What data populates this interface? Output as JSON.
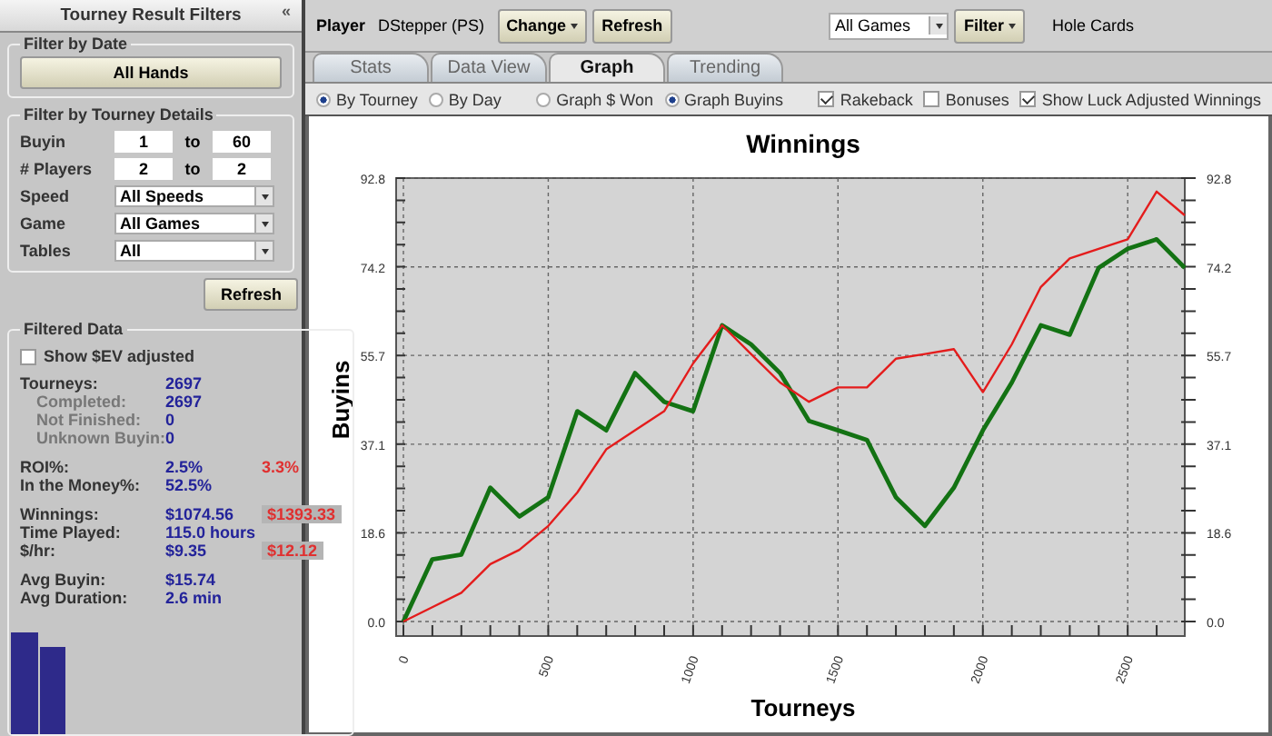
{
  "filters_panel": {
    "title": "Tourney Result Filters",
    "collapse_glyph": "«",
    "date_group": {
      "title": "Filter by Date",
      "button": "All Hands"
    },
    "details_group": {
      "title": "Filter by Tourney Details",
      "ranges": [
        {
          "label": "Buyin",
          "from": "1",
          "to_word": "to",
          "to": "60"
        },
        {
          "label": "# Players",
          "from": "2",
          "to_word": "to",
          "to": "2"
        }
      ],
      "selects": [
        {
          "label": "Speed",
          "value": "All Speeds"
        },
        {
          "label": "Game",
          "value": "All Games"
        },
        {
          "label": "Tables",
          "value": "All"
        }
      ]
    },
    "refresh_button": "Refresh",
    "data_group": {
      "title": "Filtered Data",
      "ev_checkbox": {
        "label": "Show $EV adjusted",
        "checked": false
      },
      "groups": [
        [
          {
            "label": "Tourneys:",
            "value": "2697",
            "sub": false
          },
          {
            "label": "Completed:",
            "value": "2697",
            "sub": true
          },
          {
            "label": "Not Finished:",
            "value": "0",
            "sub": true
          },
          {
            "label": "Unknown Buyin:",
            "value": "0",
            "sub": true
          }
        ],
        [
          {
            "label": "ROI%:",
            "value": "2.5%",
            "alt": "3.3%",
            "alt_boxed": false,
            "sub": false
          },
          {
            "label": "In the Money%:",
            "value": "52.5%",
            "sub": false
          }
        ],
        [
          {
            "label": "Winnings:",
            "value": "$1074.56",
            "alt": "$1393.33",
            "alt_boxed": true,
            "sub": false
          },
          {
            "label": "Time Played:",
            "value": "115.0 hours",
            "sub": false
          },
          {
            "label": "$/hr:",
            "value": "$9.35",
            "alt": "$12.12",
            "alt_boxed": true,
            "sub": false
          }
        ],
        [
          {
            "label": "Avg Buyin:",
            "value": "$15.74",
            "sub": false
          },
          {
            "label": "Avg Duration:",
            "value": "2.6 min",
            "sub": false
          }
        ]
      ]
    }
  },
  "toolbar": {
    "player_label": "Player",
    "player": "DStepper (PS)",
    "change_button": "Change",
    "refresh_button": "Refresh",
    "game_select": "All Games",
    "filter_button": "Filter",
    "hole_cards": "Hole Cards"
  },
  "tabs": [
    {
      "label": "Stats",
      "selected": false
    },
    {
      "label": "Data View",
      "selected": false
    },
    {
      "label": "Graph",
      "selected": true
    },
    {
      "label": "Trending",
      "selected": false
    }
  ],
  "options": {
    "view_by": [
      {
        "label": "By Tourney",
        "selected": true
      },
      {
        "label": "By Day",
        "selected": false
      }
    ],
    "graph_mode": [
      {
        "label": "Graph $ Won",
        "selected": false
      },
      {
        "label": "Graph Buyins",
        "selected": true
      }
    ],
    "checkboxes": [
      {
        "label": "Rakeback",
        "checked": true
      },
      {
        "label": "Bonuses",
        "checked": false
      },
      {
        "label": "Show Luck Adjusted Winnings",
        "checked": true
      }
    ]
  },
  "graph": {
    "chart_data": {
      "type": "line",
      "grid": true,
      "title": "Winnings",
      "xlabel": "Tourneys",
      "ylabel": "Buyins",
      "x": [
        0,
        100,
        200,
        300,
        400,
        500,
        600,
        700,
        800,
        900,
        1000,
        1100,
        1200,
        1300,
        1400,
        1500,
        1600,
        1700,
        1800,
        1900,
        2000,
        2100,
        2200,
        2300,
        2400,
        2500,
        2600,
        2697
      ],
      "series": [
        {
          "color": "#137213",
          "values": [
            0,
            13,
            14,
            28,
            22,
            26,
            44,
            40,
            52,
            46,
            44,
            62,
            58,
            52,
            42,
            40,
            38,
            26,
            20,
            28,
            40,
            50,
            62,
            60,
            74,
            78,
            80,
            74
          ]
        },
        {
          "color": "#e41c1c",
          "values": [
            0,
            3,
            6,
            12,
            15,
            20,
            27,
            36,
            40,
            44,
            54,
            62,
            56,
            50,
            46,
            49,
            49,
            55,
            56,
            57,
            48,
            58,
            70,
            76,
            78,
            80,
            90,
            85
          ]
        }
      ],
      "xlim": [
        0,
        2697
      ],
      "ylim": [
        0,
        92.8
      ],
      "xticks": [
        0,
        500,
        1000,
        1500,
        2000,
        2500
      ],
      "yticks": [
        {
          "value": 0,
          "label": "0.0"
        },
        {
          "value": 18.6,
          "label": "18.6"
        },
        {
          "value": 37.1,
          "label": "37.1"
        },
        {
          "value": 55.7,
          "label": "55.7"
        },
        {
          "value": 74.2,
          "label": "74.2"
        },
        {
          "value": 92.8,
          "label": "92.8"
        }
      ]
    }
  }
}
